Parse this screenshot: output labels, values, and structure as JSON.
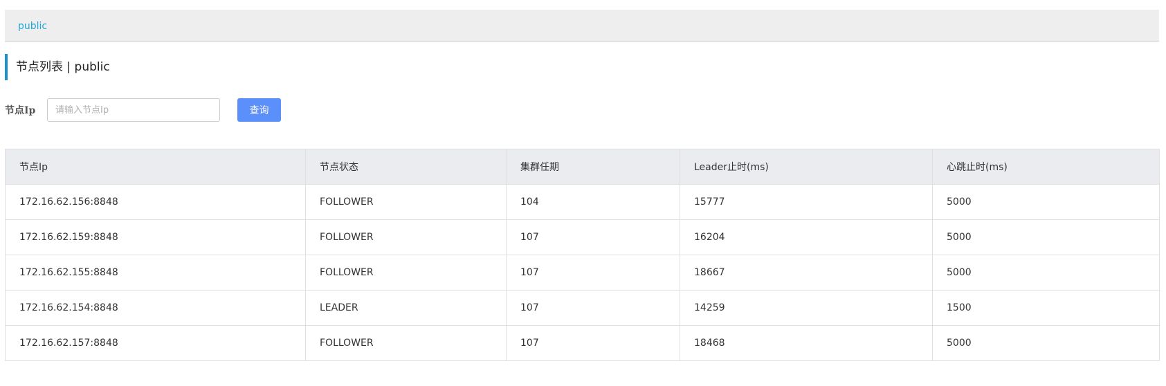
{
  "breadcrumb": {
    "link": "public"
  },
  "page_title": "节点列表  |  public",
  "search": {
    "label": "节点Ip",
    "placeholder": "请输入节点Ip",
    "value": "",
    "button_label": "查询"
  },
  "table": {
    "headers": [
      "节点Ip",
      "节点状态",
      "集群任期",
      "Leader止时(ms)",
      "心跳止时(ms)"
    ],
    "rows": [
      [
        "172.16.62.156:8848",
        "FOLLOWER",
        "104",
        "15777",
        "5000"
      ],
      [
        "172.16.62.159:8848",
        "FOLLOWER",
        "107",
        "16204",
        "5000"
      ],
      [
        "172.16.62.155:8848",
        "FOLLOWER",
        "107",
        "18667",
        "5000"
      ],
      [
        "172.16.62.154:8848",
        "LEADER",
        "107",
        "14259",
        "1500"
      ],
      [
        "172.16.62.157:8848",
        "FOLLOWER",
        "107",
        "18468",
        "5000"
      ]
    ]
  },
  "colors": {
    "accent": "#1b91c7",
    "link": "#23a7d9",
    "primary_button": "#5b8ff9",
    "header_bg": "#ebecf0",
    "breadcrumb_bg": "#eeeeee"
  }
}
